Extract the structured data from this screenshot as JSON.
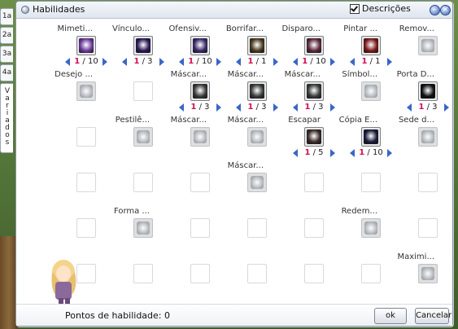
{
  "window": {
    "title": "Habilidades",
    "descriptions_label": "Descrições",
    "descriptions_checked": true
  },
  "tabs": [
    "1a",
    "2a",
    "3a",
    "4a",
    "Variados"
  ],
  "skills": [
    {
      "name": "Mimeti...",
      "row": 0,
      "col": 0,
      "state": "learned",
      "level": "1",
      "max": "10",
      "color": "#6b3a9a"
    },
    {
      "name": "Vínculo...",
      "row": 0,
      "col": 1,
      "state": "learned",
      "level": "1",
      "max": "3",
      "color": "#2a1a55"
    },
    {
      "name": "Ofensiv...",
      "row": 0,
      "col": 2,
      "state": "learned",
      "level": "1",
      "max": "10",
      "color": "#3a2a6a"
    },
    {
      "name": "Borrifar...",
      "row": 0,
      "col": 3,
      "state": "learned",
      "level": "1",
      "max": "1",
      "color": "#4a3a20"
    },
    {
      "name": "Disparo...",
      "row": 0,
      "col": 4,
      "state": "learned",
      "level": "1",
      "max": "10",
      "color": "#5a2a3a"
    },
    {
      "name": "Pintar ...",
      "row": 0,
      "col": 5,
      "state": "learned",
      "level": "1",
      "max": "1",
      "color": "#7a1a1a"
    },
    {
      "name": "Remov...",
      "row": 0,
      "col": 6,
      "state": "ghost"
    },
    {
      "name": "Desejo ...",
      "row": 1,
      "col": 0,
      "state": "ghost"
    },
    {
      "name": "",
      "row": 1,
      "col": 1,
      "state": "empty"
    },
    {
      "name": "Máscar...",
      "row": 1,
      "col": 2,
      "state": "learned",
      "level": "1",
      "max": "3",
      "color": "#3a3a3a"
    },
    {
      "name": "Máscar...",
      "row": 1,
      "col": 3,
      "state": "learned",
      "level": "1",
      "max": "3",
      "color": "#3a3a3a"
    },
    {
      "name": "Máscar...",
      "row": 1,
      "col": 4,
      "state": "learned",
      "level": "1",
      "max": "3",
      "color": "#3a3a3a"
    },
    {
      "name": "Símbol...",
      "row": 1,
      "col": 5,
      "state": "ghost"
    },
    {
      "name": "Porta D...",
      "row": 1,
      "col": 6,
      "state": "learned",
      "level": "1",
      "max": "3",
      "color": "#101010"
    },
    {
      "name": "",
      "row": 2,
      "col": 0,
      "state": "empty"
    },
    {
      "name": "Pestilê...",
      "row": 2,
      "col": 1,
      "state": "ghost"
    },
    {
      "name": "Máscar...",
      "row": 2,
      "col": 2,
      "state": "ghost"
    },
    {
      "name": "Máscar...",
      "row": 2,
      "col": 3,
      "state": "ghost"
    },
    {
      "name": "Escapar",
      "row": 2,
      "col": 4,
      "state": "learned",
      "level": "1",
      "max": "5",
      "color": "#3a2a2a"
    },
    {
      "name": "Cópia E...",
      "row": 2,
      "col": 5,
      "state": "learned",
      "level": "1",
      "max": "10",
      "color": "#1a1a3a"
    },
    {
      "name": "Sede d...",
      "row": 2,
      "col": 6,
      "state": "ghost"
    },
    {
      "name": "",
      "row": 3,
      "col": 0,
      "state": "empty"
    },
    {
      "name": "",
      "row": 3,
      "col": 1,
      "state": "empty"
    },
    {
      "name": "",
      "row": 3,
      "col": 2,
      "state": "empty"
    },
    {
      "name": "Máscar...",
      "row": 3,
      "col": 3,
      "state": "ghost"
    },
    {
      "name": "",
      "row": 3,
      "col": 4,
      "state": "empty"
    },
    {
      "name": "",
      "row": 3,
      "col": 5,
      "state": "empty"
    },
    {
      "name": "",
      "row": 3,
      "col": 6,
      "state": "empty"
    },
    {
      "name": "",
      "row": 4,
      "col": 0,
      "state": "empty"
    },
    {
      "name": "Forma ...",
      "row": 4,
      "col": 1,
      "state": "ghost"
    },
    {
      "name": "",
      "row": 4,
      "col": 2,
      "state": "empty"
    },
    {
      "name": "",
      "row": 4,
      "col": 3,
      "state": "empty"
    },
    {
      "name": "",
      "row": 4,
      "col": 4,
      "state": "empty"
    },
    {
      "name": "Redem...",
      "row": 4,
      "col": 5,
      "state": "ghost"
    },
    {
      "name": "",
      "row": 4,
      "col": 6,
      "state": "empty"
    },
    {
      "name": "",
      "row": 5,
      "col": 0,
      "state": "empty"
    },
    {
      "name": "",
      "row": 5,
      "col": 1,
      "state": "empty"
    },
    {
      "name": "",
      "row": 5,
      "col": 2,
      "state": "empty"
    },
    {
      "name": "",
      "row": 5,
      "col": 3,
      "state": "empty"
    },
    {
      "name": "",
      "row": 5,
      "col": 4,
      "state": "empty"
    },
    {
      "name": "",
      "row": 5,
      "col": 5,
      "state": "empty"
    },
    {
      "name": "Maximi...",
      "row": 5,
      "col": 6,
      "state": "ghost"
    }
  ],
  "footer": {
    "points_label": "Pontos de habilidade: 0",
    "ok_label": "ok",
    "cancel_label": "Cancelar"
  }
}
